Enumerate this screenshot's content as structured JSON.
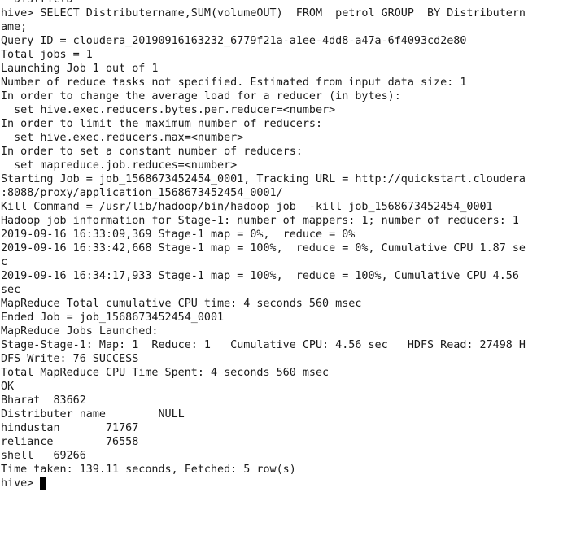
{
  "terminal": {
    "lines": [
      "  DistrictD",
      "hive> SELECT Distributername,SUM(volumeOUT)  FROM  petrol GROUP  BY Distributern",
      "ame;",
      "Query ID = cloudera_20190916163232_6779f21a-a1ee-4dd8-a47a-6f4093cd2e80",
      "Total jobs = 1",
      "Launching Job 1 out of 1",
      "Number of reduce tasks not specified. Estimated from input data size: 1",
      "In order to change the average load for a reducer (in bytes):",
      "  set hive.exec.reducers.bytes.per.reducer=<number>",
      "In order to limit the maximum number of reducers:",
      "  set hive.exec.reducers.max=<number>",
      "In order to set a constant number of reducers:",
      "  set mapreduce.job.reduces=<number>",
      "Starting Job = job_1568673452454_0001, Tracking URL = http://quickstart.cloudera",
      ":8088/proxy/application_1568673452454_0001/",
      "Kill Command = /usr/lib/hadoop/bin/hadoop job  -kill job_1568673452454_0001",
      "Hadoop job information for Stage-1: number of mappers: 1; number of reducers: 1",
      "2019-09-16 16:33:09,369 Stage-1 map = 0%,  reduce = 0%",
      "2019-09-16 16:33:42,668 Stage-1 map = 100%,  reduce = 0%, Cumulative CPU 1.87 se",
      "c",
      "2019-09-16 16:34:17,933 Stage-1 map = 100%,  reduce = 100%, Cumulative CPU 4.56",
      "sec",
      "MapReduce Total cumulative CPU time: 4 seconds 560 msec",
      "Ended Job = job_1568673452454_0001",
      "MapReduce Jobs Launched:",
      "Stage-Stage-1: Map: 1  Reduce: 1   Cumulative CPU: 4.56 sec   HDFS Read: 27498 H",
      "DFS Write: 76 SUCCESS",
      "Total MapReduce CPU Time Spent: 4 seconds 560 msec",
      "OK",
      "Bharat  83662",
      "Distributer name        NULL",
      "hindustan       71767",
      "reliance        76558",
      "shell   69266",
      "Time taken: 139.11 seconds, Fetched: 5 row(s)"
    ],
    "prompt": "hive> "
  }
}
